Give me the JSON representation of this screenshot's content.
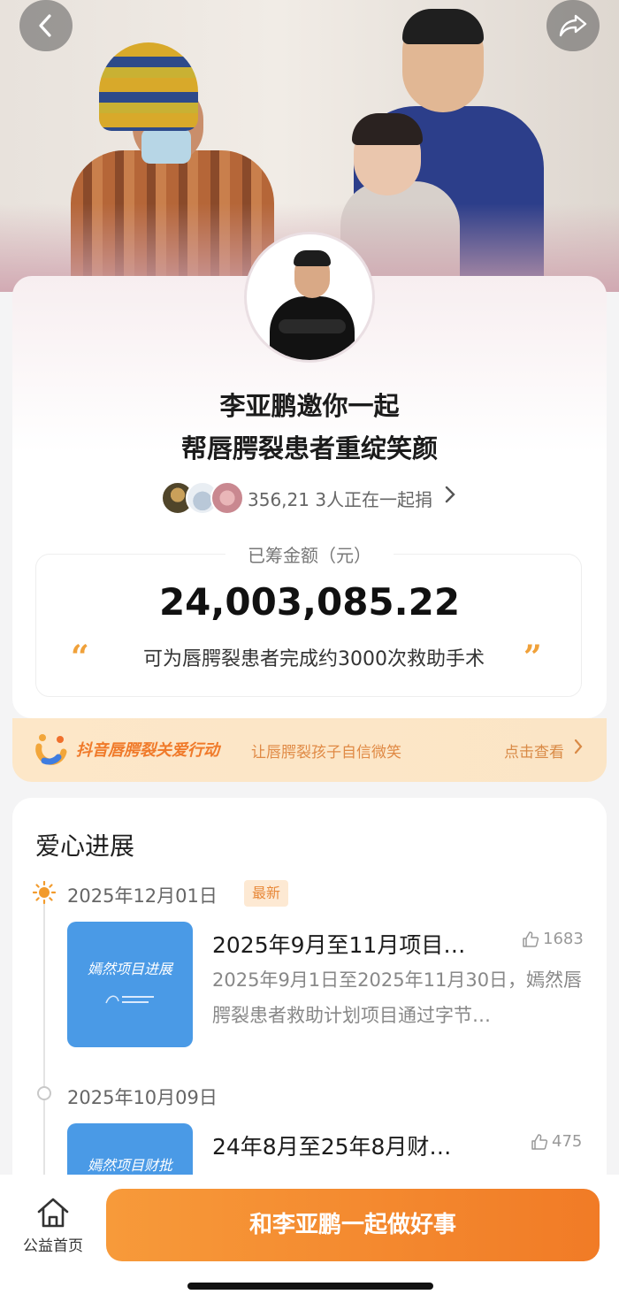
{
  "header": {
    "back_icon": "chevron-left-icon",
    "share_icon": "share-arrow-icon"
  },
  "campaign": {
    "title_line1": "李亚鹏邀你一起",
    "title_line2": "帮唇腭裂患者重绽笑颜",
    "donors_text": "356,21 3人正在一起捐",
    "raised_label": "已筹金额（元）",
    "raised_amount": "24,003,085.22",
    "impact_text": "可为唇腭裂患者完成约3000次救助手术",
    "quote_open": "“",
    "quote_close": "”"
  },
  "banner": {
    "title": "抖音唇腭裂关爱行动",
    "subtitle": "让唇腭裂孩子自信微笑",
    "link": "点击查看"
  },
  "progress": {
    "title": "爱心进展",
    "items": [
      {
        "date": "2025年12月01日",
        "badge": "最新",
        "thumb_title": "嫣然项目进展",
        "title": "2025年9月至11月项目…",
        "likes": "1683",
        "desc": "2025年9月1日至2025年11月30日，嫣然唇腭裂患者救助计划项目通过字节…"
      },
      {
        "date": "2025年10月09日",
        "thumb_title": "嫣然项目财批",
        "title": "24年8月至25年8月财…",
        "likes": "475"
      }
    ]
  },
  "bottom": {
    "home_label": "公益首页",
    "cta_label": "和李亚鹏一起做好事"
  },
  "colors": {
    "accent": "#f17b26",
    "banner_bg": "#fde7c8",
    "thumb_bg": "#4a9ae6"
  }
}
